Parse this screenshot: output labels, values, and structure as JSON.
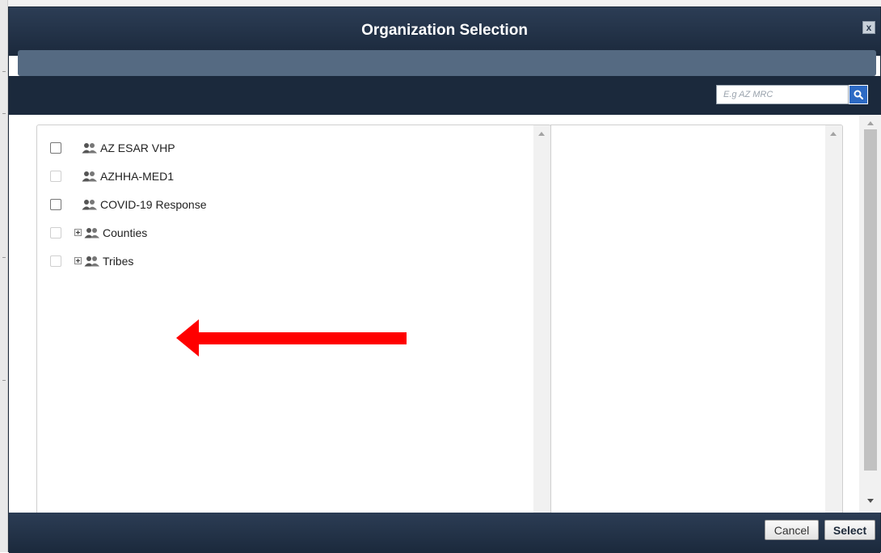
{
  "dialog": {
    "title": "Organization Selection",
    "close_label": "x"
  },
  "search": {
    "placeholder": "E.g AZ MRC",
    "value": ""
  },
  "organizations": [
    {
      "label": "AZ ESAR VHP",
      "checkbox_enabled": true,
      "expandable": false,
      "icon": "group-icon"
    },
    {
      "label": "AZHHA-MED1",
      "checkbox_enabled": false,
      "expandable": false,
      "icon": "group-icon"
    },
    {
      "label": "COVID-19 Response",
      "checkbox_enabled": true,
      "expandable": false,
      "icon": "group-icon"
    },
    {
      "label": "Counties",
      "checkbox_enabled": false,
      "expandable": true,
      "icon": "group-icon"
    },
    {
      "label": "Tribes",
      "checkbox_enabled": false,
      "expandable": true,
      "icon": "group-icon"
    }
  ],
  "annotation": {
    "arrow_color": "#ff0000",
    "points_to": "Counties"
  },
  "footer": {
    "cancel_label": "Cancel",
    "select_label": "Select"
  },
  "colors": {
    "title_bar": "#1b293c",
    "band": "#556a82",
    "search_button": "#2d6ac4"
  }
}
